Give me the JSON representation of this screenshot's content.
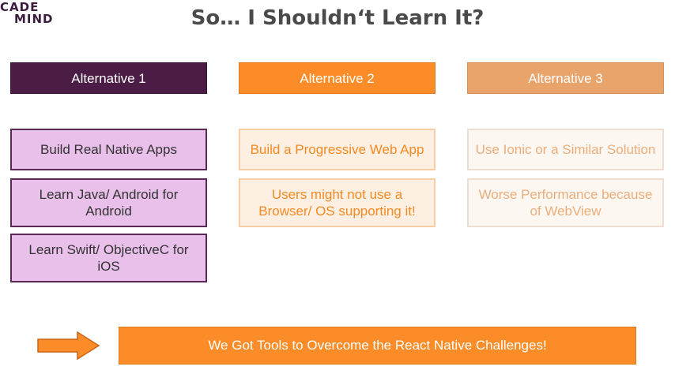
{
  "logo": {
    "line1": "CADE",
    "line2": "MIND"
  },
  "title": "So… I Shouldn‘t Learn It?",
  "columns": [
    {
      "header": "Alternative 1",
      "items": [
        "Build Real Native Apps",
        "Learn Java/ Android for Android",
        "Learn Swift/ ObjectiveC for iOS"
      ]
    },
    {
      "header": "Alternative 2",
      "items": [
        "Build a Progressive Web App",
        "Users might not use a Browser/ OS supporting it!"
      ]
    },
    {
      "header": "Alternative 3",
      "items": [
        "Use Ionic or a Similar Solution",
        "Worse Performance because of WebView"
      ]
    }
  ],
  "banner": "We Got Tools to Overcome the React Native Challenges!",
  "colors": {
    "alt1": "#4b1d46",
    "alt2": "#fb8c27",
    "alt3": "#e9a46c",
    "alt1_item_bg": "#e8c0ea"
  }
}
